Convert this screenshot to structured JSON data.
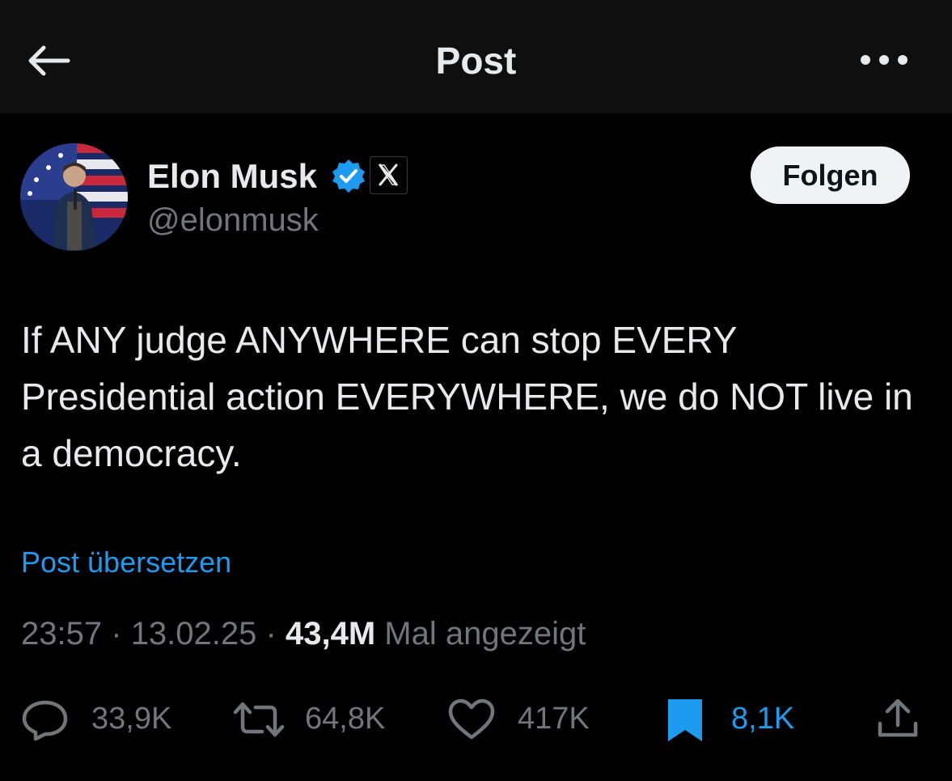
{
  "header": {
    "title": "Post"
  },
  "author": {
    "name": "Elon Musk",
    "handle": "@elonmusk",
    "verified": true,
    "affiliation_badge": "X"
  },
  "follow_label": "Folgen",
  "post": {
    "text": "If ANY judge ANYWHERE can stop EVERY Presidential action EVERYWHERE, we do NOT live in a democracy.",
    "translate_label": "Post übersetzen",
    "time": "23:57",
    "separator": "·",
    "date": "13.02.25",
    "views": "43,4M",
    "views_label": "Mal angezeigt"
  },
  "actions": {
    "replies": "33,9K",
    "reposts": "64,8K",
    "likes": "417K",
    "bookmarks": "8,1K",
    "bookmarked": true
  },
  "colors": {
    "background": "#000000",
    "header_background": "#0f0f0f",
    "text": "#e7e9ea",
    "secondary_text": "#71767b",
    "accent_blue": "#1d9bf0",
    "follow_button_bg": "#eff3f4"
  },
  "icons": [
    "back-arrow-icon",
    "more-dots-icon",
    "verified-badge-icon",
    "x-logo-icon",
    "reply-icon",
    "repost-icon",
    "like-icon",
    "bookmark-icon",
    "share-icon"
  ]
}
